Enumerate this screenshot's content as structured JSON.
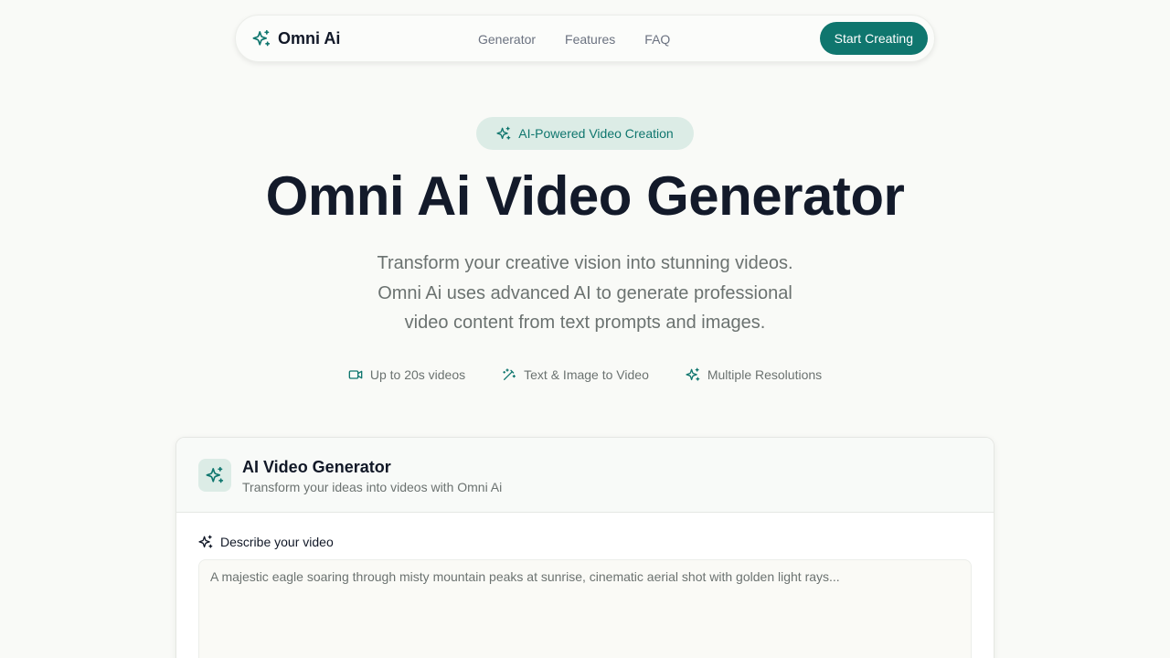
{
  "nav": {
    "brand": "Omni Ai",
    "links": [
      "Generator",
      "Features",
      "FAQ"
    ],
    "cta": "Start Creating"
  },
  "hero": {
    "badge": "AI-Powered Video Creation",
    "title": "Omni Ai Video Generator",
    "subtitle_lines": [
      "Transform your creative vision into stunning videos.",
      "Omni Ai uses advanced AI to generate professional",
      "video content from text prompts and images."
    ],
    "features": [
      {
        "icon": "video-icon",
        "label": "Up to 20s videos"
      },
      {
        "icon": "magic-wand-icon",
        "label": "Text & Image to Video"
      },
      {
        "icon": "sparkles-icon",
        "label": "Multiple Resolutions"
      }
    ]
  },
  "generator": {
    "title": "AI Video Generator",
    "subtitle": "Transform your ideas into videos with Omni Ai",
    "prompt_label": "Describe your video",
    "prompt_placeholder": "A majestic eagle soaring through misty mountain peaks at sunrise, cinematic aerial shot with golden light rays...",
    "prompt_value": ""
  },
  "colors": {
    "accent": "#0f766e",
    "badge_bg": "#dcece6",
    "page_bg": "#f9faf7"
  }
}
